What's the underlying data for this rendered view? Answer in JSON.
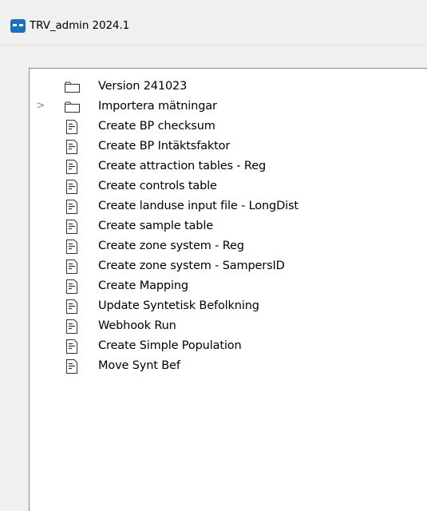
{
  "window": {
    "title": "TRV_admin 2024.1",
    "accent": "#1d6fbf"
  },
  "tree": {
    "items": [
      {
        "label": "Version 241023",
        "icon": "folder-icon",
        "expandable": false
      },
      {
        "label": "Importera mätningar",
        "icon": "folder-icon",
        "expandable": true
      },
      {
        "label": "Create BP checksum",
        "icon": "document-icon"
      },
      {
        "label": "Create BP Intäktsfaktor",
        "icon": "document-icon"
      },
      {
        "label": "Create attraction tables - Reg",
        "icon": "document-icon"
      },
      {
        "label": "Create controls table",
        "icon": "document-icon"
      },
      {
        "label": "Create landuse input file - LongDist",
        "icon": "document-icon"
      },
      {
        "label": "Create sample table",
        "icon": "document-icon"
      },
      {
        "label": "Create zone system - Reg",
        "icon": "document-icon"
      },
      {
        "label": "Create zone system - SampersID",
        "icon": "document-icon"
      },
      {
        "label": "Create Mapping",
        "icon": "document-icon"
      },
      {
        "label": "Update Syntetisk Befolkning",
        "icon": "document-icon"
      },
      {
        "label": "Webhook Run",
        "icon": "document-icon"
      },
      {
        "label": "Create Simple Population",
        "icon": "document-icon"
      },
      {
        "label": "Move Synt Bef",
        "icon": "document-icon"
      }
    ],
    "expander_glyph": ">"
  }
}
